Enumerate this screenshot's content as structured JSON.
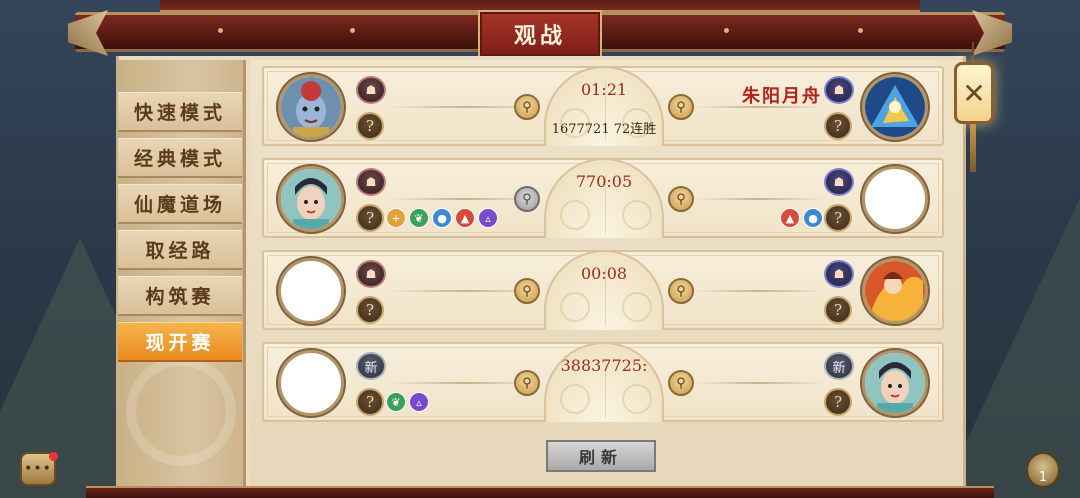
{
  "window": {
    "title": "观战"
  },
  "sidebar": {
    "tabs": [
      {
        "label": "快速模式",
        "active": false
      },
      {
        "label": "经典模式",
        "active": false
      },
      {
        "label": "仙魔道场",
        "active": false
      },
      {
        "label": "取经路",
        "active": false
      },
      {
        "label": "构筑赛",
        "active": false
      },
      {
        "label": "现开赛",
        "active": true
      }
    ]
  },
  "matches": [
    {
      "timer": "01:21",
      "stats": "1677721   72连胜",
      "right_name": "朱阳月舟",
      "left_skills": [],
      "right_skills": []
    },
    {
      "timer": "770:05",
      "stats": "",
      "right_name": "",
      "left_skills": [
        "plus-icon",
        "leaf-icon",
        "water-icon",
        "fire-icon",
        "mountain-icon"
      ],
      "right_skills": [
        "fire-icon",
        "water-icon"
      ]
    },
    {
      "timer": "00:08",
      "stats": "",
      "right_name": "",
      "left_skills": [],
      "right_skills": []
    },
    {
      "timer": "38837725:",
      "stats": "",
      "right_name": "",
      "left_skills": [
        "leaf-icon",
        "mountain-icon"
      ],
      "right_skills": []
    }
  ],
  "labels": {
    "unknown": "?",
    "new_badge": "新",
    "search_glyph": "⚲"
  },
  "refresh_label": "刷新",
  "close_glyph": "✕",
  "bag_count": "1",
  "colors": {
    "accent_red": "#b4231a",
    "active_tab": "#e88a1e",
    "frame_red": "#7a2a1f",
    "panel_bg": "#e9dcc1"
  }
}
